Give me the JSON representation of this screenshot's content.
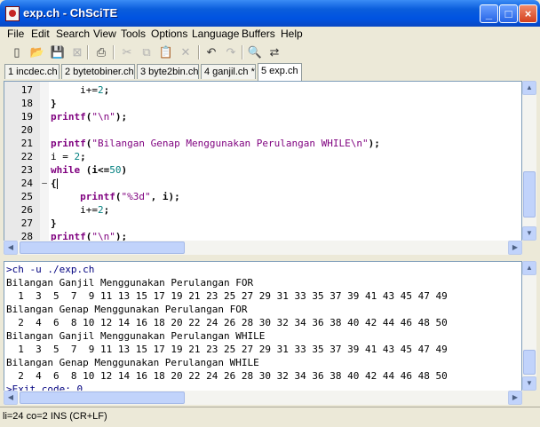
{
  "window": {
    "title": "exp.ch - ChSciTE",
    "min_symbol": "_",
    "max_symbol": "□",
    "close_symbol": "×"
  },
  "menu": [
    "File",
    "Edit",
    "Search",
    "View",
    "Tools",
    "Options",
    "Language",
    "Buffers",
    "Help"
  ],
  "toolbar": {
    "icons": [
      "new-file-icon",
      "open-folder-icon",
      "save-icon",
      "close-file-icon",
      "print-icon",
      "cut-icon",
      "copy-icon",
      "paste-icon",
      "delete-icon",
      "undo-icon",
      "redo-icon",
      "find-icon",
      "replace-icon"
    ],
    "glyphs": [
      "▯",
      "📂",
      "💾",
      "⊠",
      "⎙",
      "✂",
      "⧉",
      "📋",
      "✕",
      "↶",
      "↷",
      "🔍",
      "⇄"
    ]
  },
  "tabs": [
    {
      "label": "1 incdec.ch"
    },
    {
      "label": "2 bytetobiner.ch"
    },
    {
      "label": "3 byte2bin.ch"
    },
    {
      "label": "4 ganjil.ch *"
    },
    {
      "label": "5 exp.ch"
    }
  ],
  "editor": {
    "lines": [
      {
        "num": "17",
        "fold": "",
        "parts": [
          {
            "t": "     i+=",
            "c": ""
          },
          {
            "t": "2",
            "c": "nm"
          },
          {
            "t": ";",
            "c": "op"
          }
        ]
      },
      {
        "num": "18",
        "fold": "",
        "parts": [
          {
            "t": "}",
            "c": "op"
          }
        ]
      },
      {
        "num": "19",
        "fold": "",
        "parts": [
          {
            "t": "printf",
            "c": "kw"
          },
          {
            "t": "(",
            "c": "op"
          },
          {
            "t": "\"\\n\"",
            "c": "st"
          },
          {
            "t": ");",
            "c": "op"
          }
        ]
      },
      {
        "num": "20",
        "fold": "",
        "parts": []
      },
      {
        "num": "21",
        "fold": "",
        "parts": [
          {
            "t": "printf",
            "c": "kw"
          },
          {
            "t": "(",
            "c": "op"
          },
          {
            "t": "\"Bilangan Genap Menggunakan Perulangan WHILE\\n\"",
            "c": "st"
          },
          {
            "t": ");",
            "c": "op"
          }
        ]
      },
      {
        "num": "22",
        "fold": "",
        "parts": [
          {
            "t": "i = ",
            "c": ""
          },
          {
            "t": "2",
            "c": "nm"
          },
          {
            "t": ";",
            "c": "op"
          }
        ]
      },
      {
        "num": "23",
        "fold": "",
        "parts": [
          {
            "t": "while",
            "c": "kw"
          },
          {
            "t": " (i<=",
            "c": "op"
          },
          {
            "t": "50",
            "c": "nm"
          },
          {
            "t": ")",
            "c": "op"
          }
        ]
      },
      {
        "num": "24",
        "fold": "−",
        "parts": [
          {
            "t": "{",
            "c": "op"
          }
        ]
      },
      {
        "num": "25",
        "fold": "",
        "parts": [
          {
            "t": "     printf",
            "c": "kw"
          },
          {
            "t": "(",
            "c": "op"
          },
          {
            "t": "\"%3d\"",
            "c": "st"
          },
          {
            "t": ", i);",
            "c": "op"
          }
        ]
      },
      {
        "num": "26",
        "fold": "",
        "parts": [
          {
            "t": "     i+=",
            "c": ""
          },
          {
            "t": "2",
            "c": "nm"
          },
          {
            "t": ";",
            "c": "op"
          }
        ]
      },
      {
        "num": "27",
        "fold": "",
        "parts": [
          {
            "t": "}",
            "c": "op"
          }
        ]
      },
      {
        "num": "28",
        "fold": "",
        "parts": [
          {
            "t": "printf",
            "c": "kw"
          },
          {
            "t": "(",
            "c": "op"
          },
          {
            "t": "\"\\n\"",
            "c": "st"
          },
          {
            "t": ");",
            "c": "op"
          }
        ]
      }
    ]
  },
  "output": {
    "lines": [
      {
        "text": ">ch -u ./exp.ch",
        "cmd": true
      },
      {
        "text": "Bilangan Ganjil Menggunakan Perulangan FOR",
        "cmd": false
      },
      {
        "text": "  1  3  5  7  9 11 13 15 17 19 21 23 25 27 29 31 33 35 37 39 41 43 45 47 49",
        "cmd": false
      },
      {
        "text": "Bilangan Genap Menggunakan Perulangan FOR",
        "cmd": false
      },
      {
        "text": "  2  4  6  8 10 12 14 16 18 20 22 24 26 28 30 32 34 36 38 40 42 44 46 48 50",
        "cmd": false
      },
      {
        "text": "Bilangan Ganjil Menggunakan Perulangan WHILE",
        "cmd": false
      },
      {
        "text": "  1  3  5  7  9 11 13 15 17 19 21 23 25 27 29 31 33 35 37 39 41 43 45 47 49",
        "cmd": false
      },
      {
        "text": "Bilangan Genap Menggunakan Perulangan WHILE",
        "cmd": false
      },
      {
        "text": "  2  4  6  8 10 12 14 16 18 20 22 24 26 28 30 32 34 36 38 40 42 44 46 48 50",
        "cmd": false
      },
      {
        "text": ">Exit code: 0",
        "cmd": true
      }
    ]
  },
  "scroll": {
    "up": "▲",
    "down": "▼",
    "left": "◀",
    "right": "▶"
  },
  "status": "li=24 co=2 INS (CR+LF)"
}
